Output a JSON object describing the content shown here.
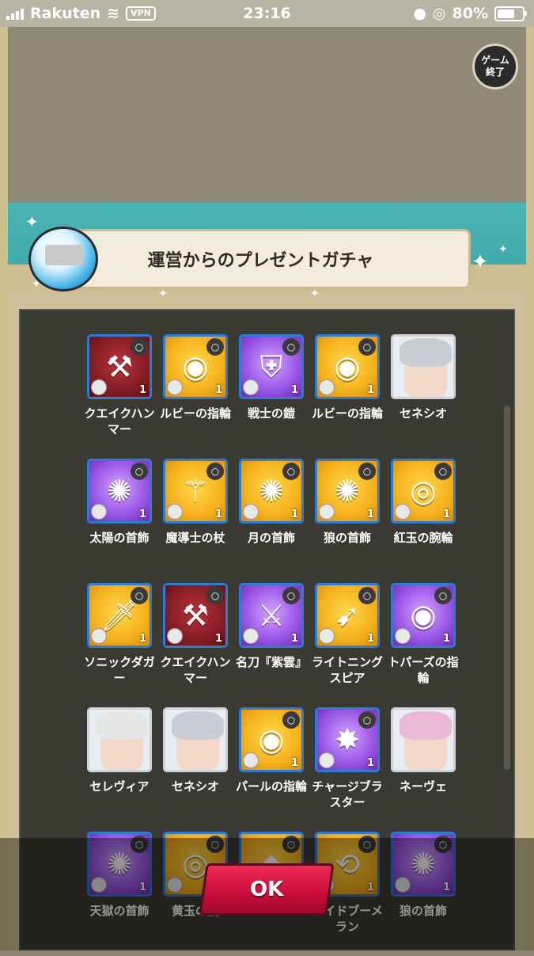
{
  "status_bar": {
    "carrier": "Rakuten",
    "vpn": "VPN",
    "time": "23:16",
    "battery": "80%",
    "battery_level": 0.8
  },
  "game": {
    "end_button": "ゲーム\n終了"
  },
  "dialog": {
    "title": "運営からのプレゼントガチャ",
    "items": [
      {
        "name": "クエイクハンマー",
        "rarity": "red",
        "icon": "hammer-icon",
        "level": "1"
      },
      {
        "name": "ルビーの指輪",
        "rarity": "yellow",
        "icon": "ring-icon",
        "level": "1"
      },
      {
        "name": "戦士の鎧",
        "rarity": "purple",
        "icon": "armor-icon",
        "level": "1"
      },
      {
        "name": "ルビーの指輪",
        "rarity": "yellow",
        "icon": "ring-icon",
        "level": "1"
      },
      {
        "name": "セネシオ",
        "rarity": "portrait",
        "icon": "character-portrait",
        "hair": "#c9cdd6"
      },
      {
        "name": "太陽の首飾",
        "rarity": "purple",
        "icon": "necklace-icon",
        "level": "1"
      },
      {
        "name": "魔導士の杖",
        "rarity": "yellow",
        "icon": "staff-icon",
        "level": "1"
      },
      {
        "name": "月の首飾",
        "rarity": "yellow",
        "icon": "necklace-icon",
        "level": "1"
      },
      {
        "name": "狼の首飾",
        "rarity": "yellow",
        "icon": "necklace-icon",
        "level": "1"
      },
      {
        "name": "紅玉の腕輪",
        "rarity": "yellow",
        "icon": "bracelet-icon",
        "level": "1"
      },
      {
        "name": "ソニックダガー",
        "rarity": "yellow",
        "icon": "dagger-icon",
        "level": "1"
      },
      {
        "name": "クエイクハンマー",
        "rarity": "red",
        "icon": "hammer-icon",
        "level": "1"
      },
      {
        "name": "名刀『紫雲』",
        "rarity": "purple",
        "icon": "sword-icon",
        "level": "1"
      },
      {
        "name": "ライトニングスピア",
        "rarity": "yellow",
        "icon": "spear-icon",
        "level": "1"
      },
      {
        "name": "トパーズの指輪",
        "rarity": "purple",
        "icon": "ring-icon",
        "level": "1"
      },
      {
        "name": "セレヴィア",
        "rarity": "portrait",
        "icon": "character-portrait",
        "hair": "#e6e6e6"
      },
      {
        "name": "セネシオ",
        "rarity": "portrait",
        "icon": "character-portrait",
        "hair": "#c9cdd6"
      },
      {
        "name": "パールの指輪",
        "rarity": "yellow",
        "icon": "ring-icon",
        "level": "1"
      },
      {
        "name": "チャージブラスター",
        "rarity": "purple",
        "icon": "blaster-icon",
        "level": "1"
      },
      {
        "name": "ネーヴェ",
        "rarity": "portrait",
        "icon": "character-portrait",
        "hair": "#e9b9d6"
      },
      {
        "name": "天獄の首飾",
        "rarity": "purple",
        "icon": "necklace-icon",
        "level": "1"
      },
      {
        "name": "黄玉の腕",
        "rarity": "yellow",
        "icon": "bracelet-icon",
        "level": "1"
      },
      {
        "name": "",
        "rarity": "yellow",
        "icon": "gem-icon",
        "level": "1"
      },
      {
        "name": "ライドブーメラン",
        "rarity": "yellow",
        "icon": "boomerang-icon",
        "level": "1"
      },
      {
        "name": "狼の首飾",
        "rarity": "purple",
        "icon": "necklace-icon",
        "level": "1"
      }
    ],
    "ok_button": "OK"
  }
}
